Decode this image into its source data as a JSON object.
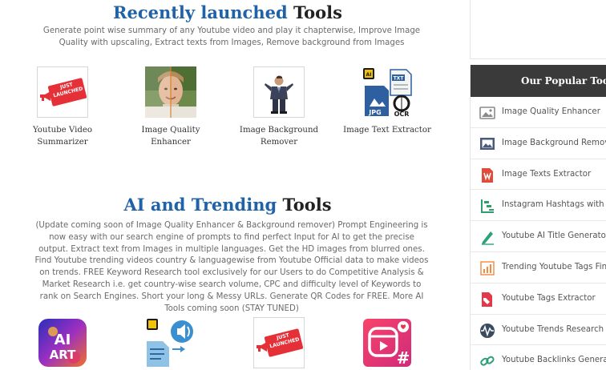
{
  "recent": {
    "title_accent": "Recently launched",
    "title_rest": "Tools",
    "description": "Generate point wise summary of any Youtube video and play it chapterwise, Improve Image Quality with upscaling, Extract texts from Images, Remove background from Images",
    "tools": [
      {
        "label": "Youtube Video Summarizer",
        "icon": "just-launched-badge"
      },
      {
        "label": "Image Quality Enhancer",
        "icon": "face-compare-photo"
      },
      {
        "label": "Image Background Remover",
        "icon": "businessman-photo"
      },
      {
        "label": "Image Text Extractor",
        "icon": "ocr-documents"
      }
    ],
    "badge_text": "JUST LAUNCHED",
    "ocr_labels": {
      "ai": "AI",
      "txt": "TXT",
      "jpg": "JPG",
      "ocr": "OCR"
    }
  },
  "trending": {
    "title_accent": "AI and Trending",
    "title_rest": "Tools",
    "description": "(Update coming soon of Image Quality Enhancer & Background remover) Prompt Engineering is now easy with our search engine of prompts to find perfect Input for AI to get the precise output. Extract text from Images in multiple languages. Get the HD images from blurred ones. Find Youtube trending videos country & languagewise from Youtube Official data to make videos on trends. FREE Keyword Research tool exclusively for our Users to do Competitive Analysis & Market Research i.e. get country-wise search volume, CPC and difficulty level of Keywords to rank on Search Engines. Short your long & Messy URLs. Generate QR Codes for FREE. More AI Tools coming soon (STAY TUNED)",
    "tools": [
      {
        "icon": "ai-art-app"
      },
      {
        "icon": "ai-text-to-speech"
      },
      {
        "icon": "just-launched-badge"
      },
      {
        "icon": "reels-hashtag"
      }
    ],
    "ai_art_text": {
      "line1": "AI",
      "line2": "ART"
    },
    "hash_symbol": "#"
  },
  "sidebar": {
    "heading": "Our Popular Tools",
    "items": [
      {
        "label": "Image Quality Enhancer",
        "icon": "image-icon",
        "color": "#8a8a8a"
      },
      {
        "label": "Image Background Remover",
        "icon": "photo-frame-icon",
        "color": "#4a5a7a"
      },
      {
        "label": "Image Texts Extractor",
        "icon": "word-doc-icon",
        "color": "#e14c3a"
      },
      {
        "label": "Instagram Hashtags with Re",
        "icon": "flow-chart-icon",
        "color": "#2f9e6c"
      },
      {
        "label": "Youtube AI Title Generator",
        "icon": "pen-icon",
        "color": "#2aa37a"
      },
      {
        "label": "Trending Youtube Tags Find",
        "icon": "bar-chart-icon",
        "color": "#f08a3e"
      },
      {
        "label": "Youtube Tags Extractor",
        "icon": "tag-file-icon",
        "color": "#e2384a"
      },
      {
        "label": "Youtube Trends Research",
        "icon": "wave-globe-icon",
        "color": "#3a4a60"
      },
      {
        "label": "Youtube Backlinks Generato",
        "icon": "link-icon",
        "color": "#2a9d7a"
      }
    ]
  }
}
